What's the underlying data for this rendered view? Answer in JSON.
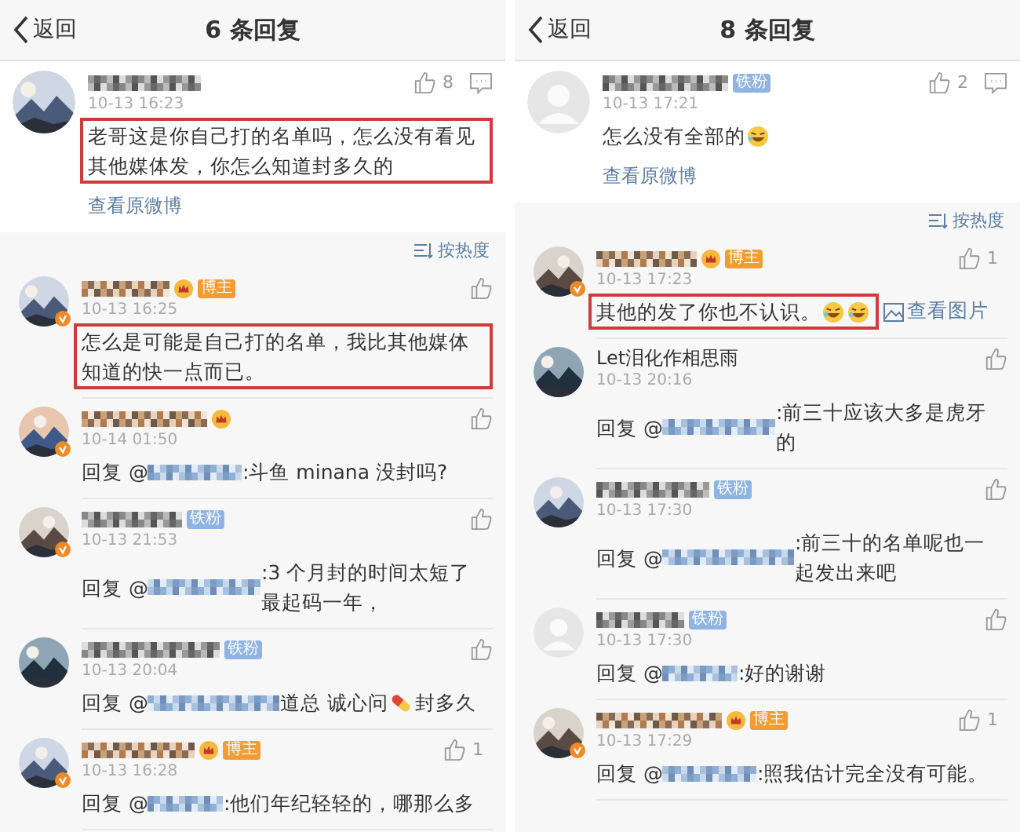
{
  "panels": [
    {
      "header": {
        "back": "返回",
        "title": "6 条回复"
      },
      "main": {
        "avatar": {
          "kind": "picture"
        },
        "vip": false,
        "likes": "8",
        "time": "10-13 16:23",
        "highlighted": true,
        "segments": [
          {
            "kind": "text",
            "text": "老哥这是你自己打的名单吗，怎么没有看见其他媒体发，你怎么知道封多久的"
          }
        ],
        "link": "查看原微博"
      },
      "sort": "按热度",
      "replies": [
        {
          "avatar": {
            "kind": "picture"
          },
          "verified": true,
          "vip": true,
          "badge": {
            "kind": "blogger",
            "text": "博主"
          },
          "time": "10-13 16:25",
          "highlighted": true,
          "segments": [
            {
              "kind": "text",
              "text": "怎么是可能是自己打的名单，我比其他媒体知道的快一点而已。"
            }
          ]
        },
        {
          "avatar": {
            "kind": "picture"
          },
          "verified": true,
          "vip": true,
          "time": "10-14 01:50",
          "highlighted": false,
          "segments": [
            {
              "kind": "text",
              "text": "回复 @"
            },
            {
              "kind": "mention"
            },
            {
              "kind": "text",
              "text": ":斗鱼 minana 没封吗?"
            }
          ]
        },
        {
          "avatar": {
            "kind": "picture"
          },
          "verified": true,
          "vip": false,
          "badge": {
            "kind": "fan",
            "text": "铁粉"
          },
          "time": "10-13 21:53",
          "highlighted": false,
          "segments": [
            {
              "kind": "text",
              "text": "回复 @"
            },
            {
              "kind": "mention"
            },
            {
              "kind": "text",
              "text": ":3 个月封的时间太短了最起码一年，"
            }
          ]
        },
        {
          "avatar": {
            "kind": "picture"
          },
          "verified": false,
          "vip": false,
          "badge": {
            "kind": "fan",
            "text": "铁粉"
          },
          "time": "10-13 20:04",
          "highlighted": false,
          "segments": [
            {
              "kind": "text",
              "text": "回复 @"
            },
            {
              "kind": "mention"
            },
            {
              "kind": "text",
              "text": "道总 诚心问"
            },
            {
              "kind": "pill"
            },
            {
              "kind": "text",
              "text": "封多久"
            }
          ]
        },
        {
          "avatar": {
            "kind": "picture"
          },
          "verified": true,
          "vip": true,
          "badge": {
            "kind": "blogger",
            "text": "博主"
          },
          "likes": "1",
          "time": "10-13 16:28",
          "highlighted": false,
          "segments": [
            {
              "kind": "text",
              "text": "回复 @"
            },
            {
              "kind": "mention"
            },
            {
              "kind": "text",
              "text": ":他们年纪轻轻的，哪那么多"
            }
          ]
        }
      ]
    },
    {
      "header": {
        "back": "返回",
        "title": "8 条回复"
      },
      "main": {
        "avatar": {
          "kind": "default"
        },
        "vip": false,
        "badge": {
          "kind": "fan",
          "text": "铁粉"
        },
        "likes": "2",
        "time": "10-13 17:21",
        "highlighted": false,
        "segments": [
          {
            "kind": "text",
            "text": "怎么没有全部的"
          },
          {
            "kind": "laugh"
          }
        ],
        "link": "查看原微博"
      },
      "sort": "按热度",
      "replies": [
        {
          "avatar": {
            "kind": "picture"
          },
          "verified": true,
          "vip": true,
          "badge": {
            "kind": "blogger",
            "text": "博主"
          },
          "likes": "1",
          "time": "10-13 17:23",
          "highlighted": true,
          "segments": [
            {
              "kind": "text",
              "text": "其他的发了你也不认识。"
            },
            {
              "kind": "laugh"
            },
            {
              "kind": "laugh"
            }
          ],
          "image_link": "查看图片"
        },
        {
          "avatar": {
            "kind": "picture"
          },
          "verified": false,
          "vip": false,
          "name": "Let泪化作相思雨",
          "time": "10-13 20:16",
          "highlighted": false,
          "segments": [
            {
              "kind": "text",
              "text": "回复 @"
            },
            {
              "kind": "mention"
            },
            {
              "kind": "text",
              "text": ":前三十应该大多是虎牙的"
            }
          ]
        },
        {
          "avatar": {
            "kind": "picture"
          },
          "verified": false,
          "vip": false,
          "badge": {
            "kind": "fan",
            "text": "铁粉"
          },
          "time": "10-13 17:30",
          "highlighted": false,
          "segments": [
            {
              "kind": "text",
              "text": "回复 @"
            },
            {
              "kind": "mention"
            },
            {
              "kind": "text",
              "text": ":前三十的名单呢也一起发出来吧"
            }
          ]
        },
        {
          "avatar": {
            "kind": "default"
          },
          "verified": false,
          "vip": false,
          "badge": {
            "kind": "fan",
            "text": "铁粉"
          },
          "time": "10-13 17:30",
          "highlighted": false,
          "segments": [
            {
              "kind": "text",
              "text": "回复 @"
            },
            {
              "kind": "mention"
            },
            {
              "kind": "text",
              "text": ":好的谢谢"
            }
          ]
        },
        {
          "avatar": {
            "kind": "picture"
          },
          "verified": true,
          "vip": true,
          "badge": {
            "kind": "blogger",
            "text": "博主"
          },
          "likes": "1",
          "time": "10-13 17:29",
          "highlighted": false,
          "segments": [
            {
              "kind": "text",
              "text": "回复 @"
            },
            {
              "kind": "mention"
            },
            {
              "kind": "text",
              "text": ":照我估计完全没有可能。"
            }
          ]
        }
      ]
    }
  ]
}
